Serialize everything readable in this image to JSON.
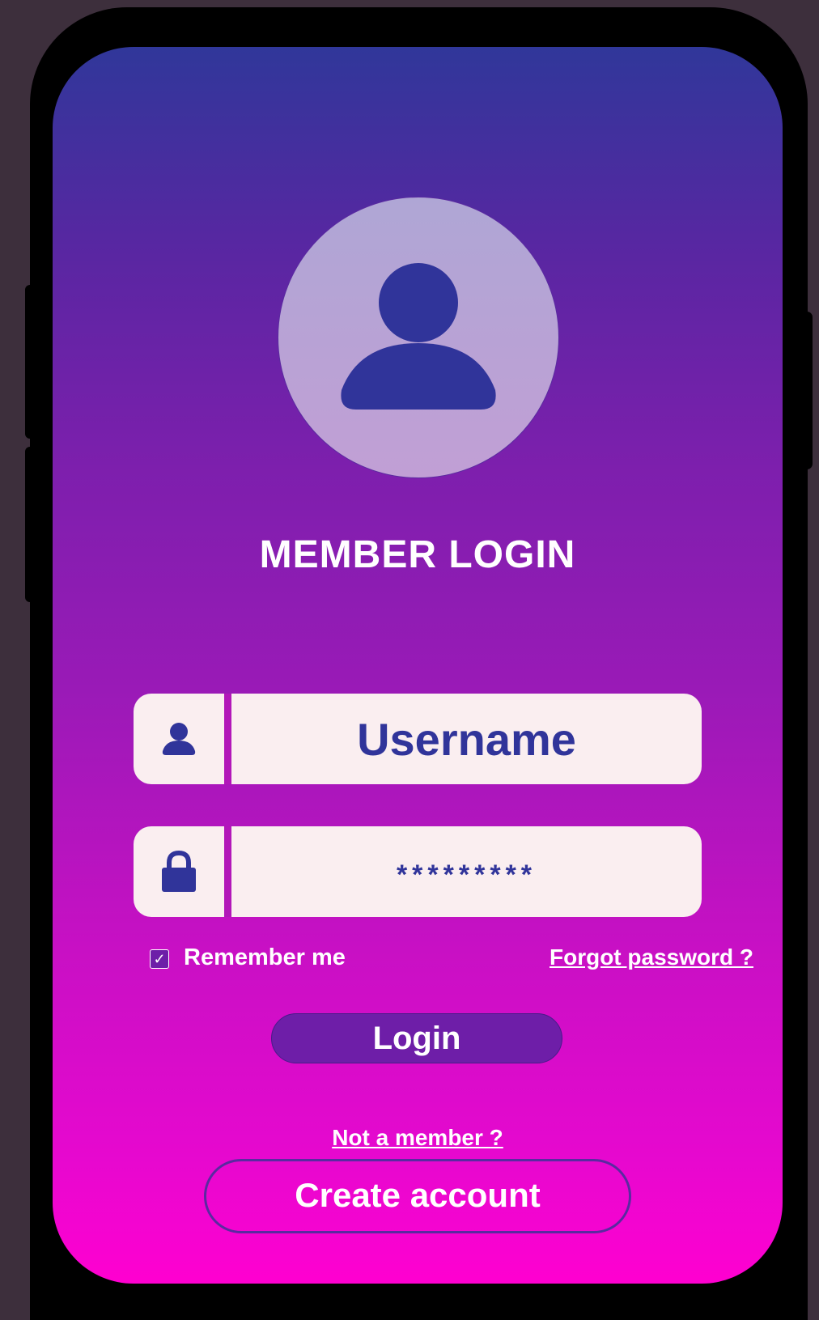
{
  "title": "MEMBER LOGIN",
  "username": {
    "placeholder": "Username",
    "icon": "user-icon"
  },
  "password": {
    "value": "*********",
    "icon": "lock-icon"
  },
  "remember": {
    "label": "Remember me",
    "checked": true,
    "check_mark": "✓"
  },
  "forgot_link": "Forgot password ?",
  "login_button": "Login",
  "not_member_link": "Not a member ?",
  "create_account_button": "Create account",
  "colors": {
    "primary": "#30349a",
    "gradient_top": "#30379a",
    "gradient_bottom": "#ff00d0",
    "field_bg": "#faeef0",
    "login_button_bg": "#6e1ea8"
  }
}
